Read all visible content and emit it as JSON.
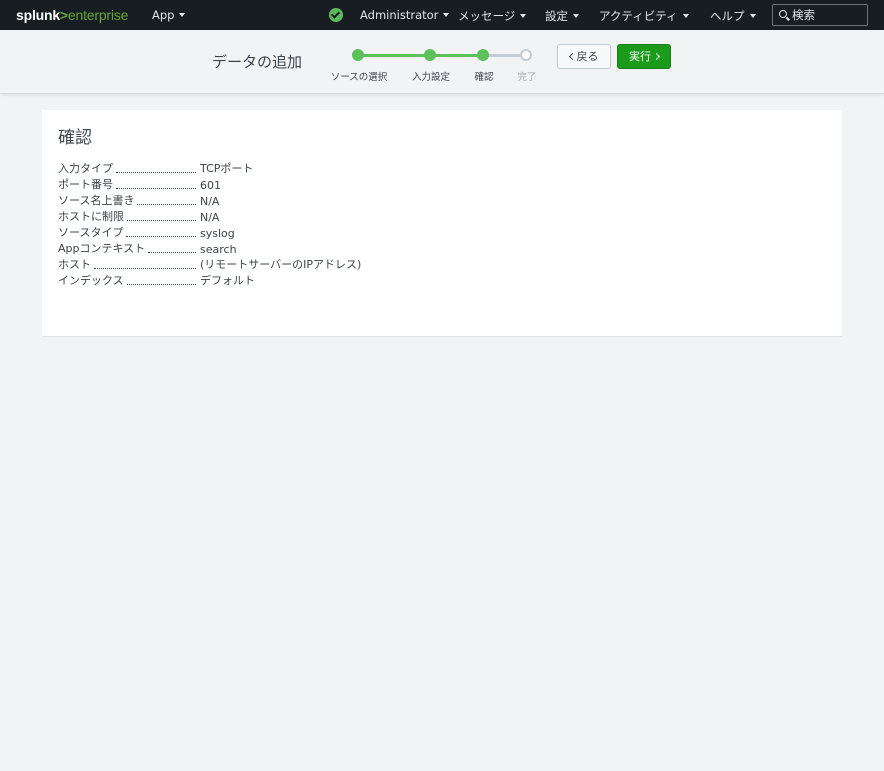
{
  "navbar": {
    "logo_main": "splunk",
    "logo_sep": ">",
    "logo_sub": "enterprise",
    "app_label": "App",
    "user_label": "Administrator",
    "messages_label": "メッセージ",
    "settings_label": "設定",
    "activity_label": "アクティビティ",
    "help_label": "ヘルプ",
    "search_placeholder": "検索"
  },
  "wizard": {
    "title": "データの追加",
    "steps": [
      {
        "label": "ソースの選択",
        "status": "done"
      },
      {
        "label": "入力設定",
        "status": "done"
      },
      {
        "label": "確認",
        "status": "current"
      },
      {
        "label": "完了",
        "status": "todo"
      }
    ],
    "back_label": "戻る",
    "next_label": "実行"
  },
  "review": {
    "title": "確認",
    "rows": [
      {
        "label": "入力タイプ",
        "value": "TCPポート"
      },
      {
        "label": "ポート番号",
        "value": "601"
      },
      {
        "label": "ソース名上書き",
        "value": "N/A"
      },
      {
        "label": "ホストに制限",
        "value": "N/A"
      },
      {
        "label": "ソースタイプ",
        "value": "syslog"
      },
      {
        "label": "Appコンテキスト",
        "value": "search"
      },
      {
        "label": "ホスト",
        "value": "(リモートサーバーのIPアドレス)"
      },
      {
        "label": "インデックス",
        "value": "デフォルト"
      }
    ]
  },
  "colors": {
    "navbar_bg": "#171d21",
    "brand_green": "#65a637",
    "step_done": "#5cc05c",
    "primary_button": "#1a9c1a",
    "page_bg": "#f2f3f5"
  }
}
